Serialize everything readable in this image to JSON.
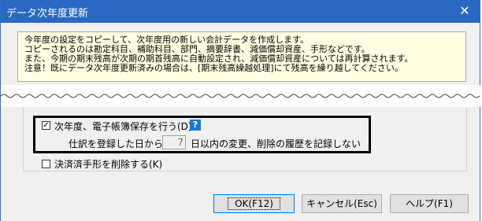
{
  "window": {
    "title": "データ次年度更新"
  },
  "notice": {
    "lines": [
      "今年度の設定をコピーして、次年度用の新しい会計データを作成します。",
      "コピーされるのは勘定科目、補助科目、部門、摘要辞書、減価償却資産、手形などです。",
      "また、今期の期末残高が次期の期首残高に自動設定され、減価償却資産については再計算されます。",
      "注意！既にデータ次年度更新済みの場合は、[期末残高繰越処理]にて残高を繰り越してください。"
    ]
  },
  "options": {
    "e_book": {
      "label": "次年度、電子帳簿保存を行う(D)",
      "checked": true,
      "help": "?"
    },
    "record_days": {
      "prefix": "仕訳を登録した日から",
      "value": "7",
      "suffix": "日以内の変更、削除の履歴を記録しない"
    },
    "delete_settled_bills": {
      "label": "決済済手形を削除する(K)",
      "checked": false
    }
  },
  "buttons": {
    "ok": "OK(F12)",
    "cancel": "キャンセル(Esc)",
    "help": "ヘルプ(F1)"
  },
  "colors": {
    "titlebar": "#2a69c3",
    "notice_bg": "#ffffe1",
    "help_icon": "#1a78d2"
  }
}
